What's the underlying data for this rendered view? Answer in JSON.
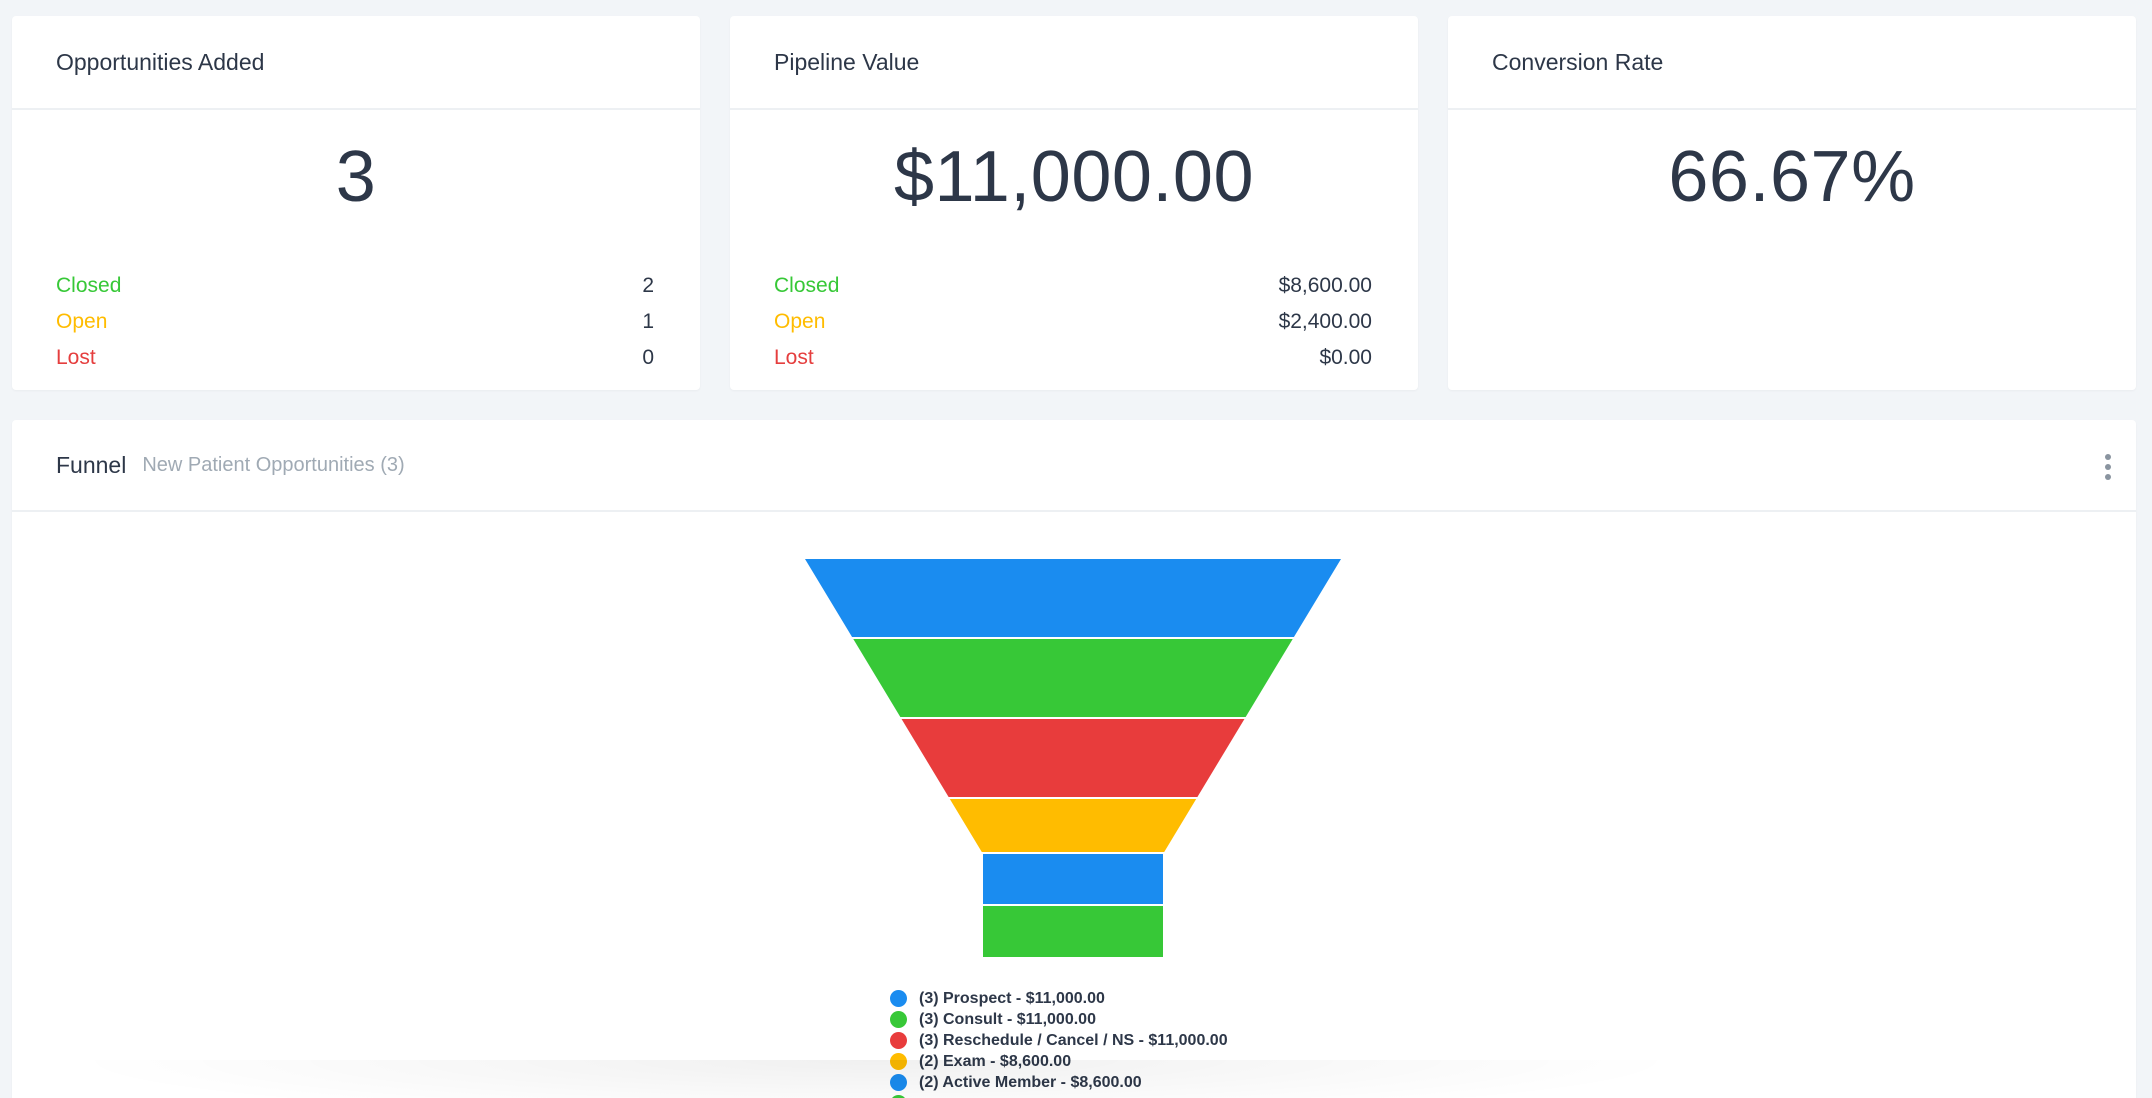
{
  "cards": [
    {
      "title": "Opportunities Added",
      "value": "3",
      "stats": [
        {
          "label": "Closed",
          "value": "2"
        },
        {
          "label": "Open",
          "value": "1"
        },
        {
          "label": "Lost",
          "value": "0"
        }
      ]
    },
    {
      "title": "Pipeline Value",
      "value": "$11,000.00",
      "stats": [
        {
          "label": "Closed",
          "value": "$8,600.00"
        },
        {
          "label": "Open",
          "value": "$2,400.00"
        },
        {
          "label": "Lost",
          "value": "$0.00"
        }
      ]
    },
    {
      "title": "Conversion Rate",
      "value": "66.67%"
    }
  ],
  "funnel": {
    "title": "Funnel",
    "subtitle": "New Patient Opportunities (3)",
    "menu_icon": "kebab-menu-icon"
  },
  "colors": {
    "closed": "#37c837",
    "open": "#ffbc00",
    "lost": "#e53e3e",
    "blue": "#1a8cf0",
    "green": "#37c837",
    "red": "#e83c3c",
    "yellow": "#ffbc00"
  },
  "chart_data": {
    "type": "funnel",
    "stages": [
      {
        "label": "(3) Prospect - $11,000.00",
        "count": 3,
        "value": 11000,
        "color": "#1a8cf0"
      },
      {
        "label": "(3) Consult - $11,000.00",
        "count": 3,
        "value": 11000,
        "color": "#37c837"
      },
      {
        "label": "(3) Reschedule / Cancel / NS - $11,000.00",
        "count": 3,
        "value": 11000,
        "color": "#e83c3c"
      },
      {
        "label": "(2) Exam - $8,600.00",
        "count": 2,
        "value": 8600,
        "color": "#ffbc00"
      },
      {
        "label": "(2) Active Member - $8,600.00",
        "count": 2,
        "value": 8600,
        "color": "#1a8cf0"
      },
      {
        "label": "",
        "count": 2,
        "value": 8600,
        "color": "#37c837"
      }
    ]
  }
}
